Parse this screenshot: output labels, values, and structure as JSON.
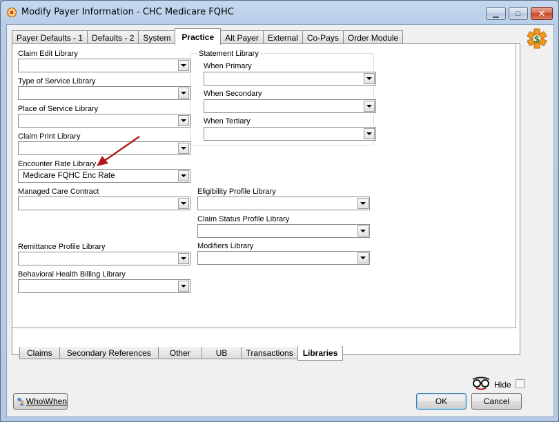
{
  "window": {
    "title": "Modify Payer Information - CHC Medicare FQHC",
    "minimize_glyph": "▁",
    "maximize_glyph": "□",
    "close_glyph": "✕"
  },
  "top_tabs": [
    {
      "label": "Payer Defaults - 1"
    },
    {
      "label": "Defaults - 2"
    },
    {
      "label": "System"
    },
    {
      "label": "Practice",
      "active": true
    },
    {
      "label": "Alt Payer"
    },
    {
      "label": "External"
    },
    {
      "label": "Co-Pays"
    },
    {
      "label": "Order Module"
    }
  ],
  "fields": {
    "claim_edit": {
      "label": "Claim Edit Library",
      "value": ""
    },
    "type_of_service": {
      "label": "Type of Service Library",
      "value": ""
    },
    "place_of_service": {
      "label": "Place of Service Library",
      "value": ""
    },
    "claim_print": {
      "label": "Claim Print Library",
      "value": ""
    },
    "encounter_rate": {
      "label": "Encounter Rate Library",
      "value": "Medicare FQHC Enc Rate"
    },
    "managed_care": {
      "label": "Managed Care Contract",
      "value": ""
    },
    "remittance": {
      "label": "Remittance Profile Library",
      "value": ""
    },
    "behavioral": {
      "label": "Behavioral Health Billing Library",
      "value": ""
    },
    "eligibility": {
      "label": "Eligibility Profile Library",
      "value": ""
    },
    "claim_status": {
      "label": "Claim Status Profile Library",
      "value": ""
    },
    "modifiers": {
      "label": "Modifiers Library",
      "value": ""
    }
  },
  "statement_library": {
    "title": "Statement Library",
    "when_primary": {
      "label": "When Primary",
      "value": ""
    },
    "when_secondary": {
      "label": "When Secondary",
      "value": ""
    },
    "when_tertiary": {
      "label": "When Tertiary",
      "value": ""
    }
  },
  "bottom_tabs": [
    {
      "label": "Claims"
    },
    {
      "label": "Secondary References"
    },
    {
      "label": "Other"
    },
    {
      "label": "UB"
    },
    {
      "label": "Transactions"
    },
    {
      "label": "Libraries",
      "active": true
    }
  ],
  "footer": {
    "who_when_label": "Who\\When",
    "hide_label": "Hide",
    "hide_checked": false,
    "ok_label": "OK",
    "cancel_label": "Cancel"
  },
  "colors": {
    "arrow_annotation": "#b21a1a"
  }
}
